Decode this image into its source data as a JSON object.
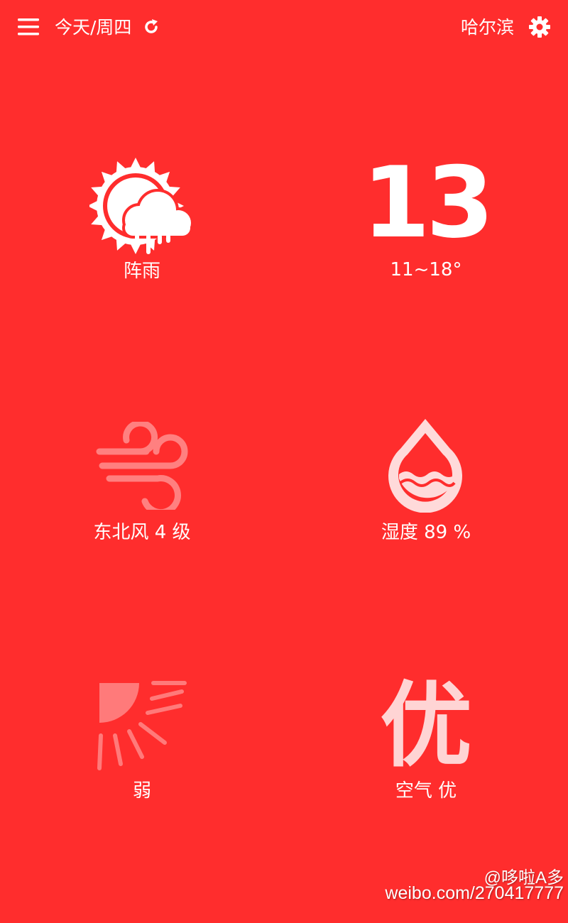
{
  "header": {
    "date_label": "今天/周四",
    "city": "哈尔滨",
    "icons": {
      "menu": "menu-icon",
      "refresh": "refresh-icon",
      "settings": "gear-icon"
    }
  },
  "weather": {
    "condition": "阵雨",
    "condition_icon": "sun-cloud-rain-icon",
    "current_temp": "13",
    "temp_range": "11~18°"
  },
  "wind": {
    "icon": "wind-icon",
    "label": "东北风 4 级"
  },
  "humidity": {
    "icon": "water-drop-icon",
    "label": "湿度  89 %"
  },
  "uv": {
    "icon": "sun-rays-icon",
    "label": "弱"
  },
  "air": {
    "big": "优",
    "label": "空气  优"
  },
  "watermark": {
    "line1": "@哆啦A多",
    "line2": "weibo.com/270417777"
  },
  "colors": {
    "background": "#ff2d2d",
    "text": "#ffffff",
    "muted_icon": "#ff8080"
  }
}
